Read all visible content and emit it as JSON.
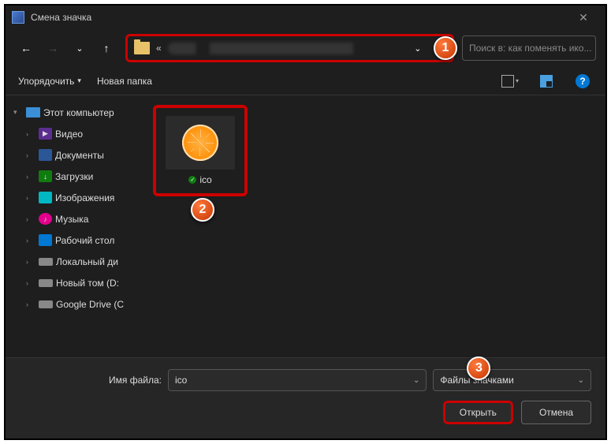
{
  "title": "Смена значка",
  "search_placeholder": "Поиск в: как поменять ико...",
  "toolbar": {
    "organize": "Упорядочить",
    "new_folder": "Новая папка"
  },
  "sidebar": {
    "root": "Этот компьютер",
    "items": [
      {
        "label": "Видео",
        "icon": "video"
      },
      {
        "label": "Документы",
        "icon": "doc"
      },
      {
        "label": "Загрузки",
        "icon": "dl"
      },
      {
        "label": "Изображения",
        "icon": "img"
      },
      {
        "label": "Музыка",
        "icon": "music"
      },
      {
        "label": "Рабочий стол",
        "icon": "desk"
      },
      {
        "label": "Локальный ди",
        "icon": "drive"
      },
      {
        "label": "Новый том (D:",
        "icon": "drive"
      },
      {
        "label": "Google Drive (C",
        "icon": "drive"
      }
    ]
  },
  "file": {
    "name": "ico"
  },
  "footer": {
    "filename_label": "Имя файла:",
    "filename_value": "ico",
    "filter_value": "Файлы значками",
    "open": "Открыть",
    "cancel": "Отмена"
  },
  "badges": {
    "b1": "1",
    "b2": "2",
    "b3": "3"
  }
}
